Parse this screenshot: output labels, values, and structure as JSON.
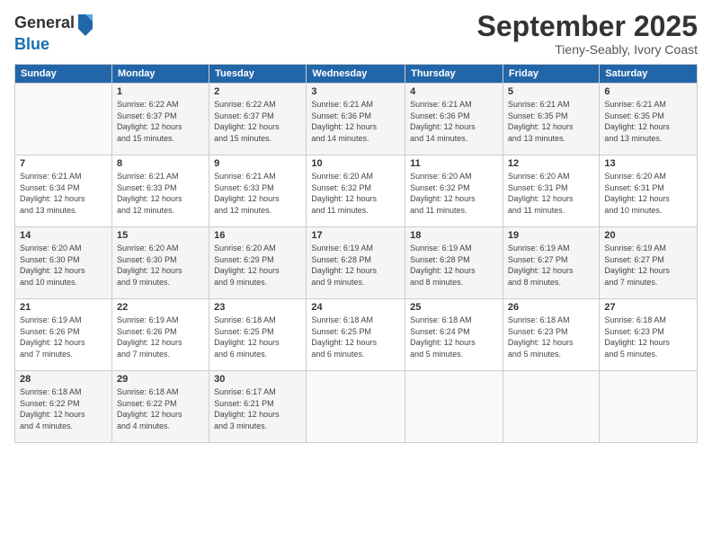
{
  "logo": {
    "general": "General",
    "blue": "Blue"
  },
  "title": "September 2025",
  "location": "Tieny-Seably, Ivory Coast",
  "days_header": [
    "Sunday",
    "Monday",
    "Tuesday",
    "Wednesday",
    "Thursday",
    "Friday",
    "Saturday"
  ],
  "weeks": [
    [
      {
        "num": "",
        "info": ""
      },
      {
        "num": "1",
        "info": "Sunrise: 6:22 AM\nSunset: 6:37 PM\nDaylight: 12 hours\nand 15 minutes."
      },
      {
        "num": "2",
        "info": "Sunrise: 6:22 AM\nSunset: 6:37 PM\nDaylight: 12 hours\nand 15 minutes."
      },
      {
        "num": "3",
        "info": "Sunrise: 6:21 AM\nSunset: 6:36 PM\nDaylight: 12 hours\nand 14 minutes."
      },
      {
        "num": "4",
        "info": "Sunrise: 6:21 AM\nSunset: 6:36 PM\nDaylight: 12 hours\nand 14 minutes."
      },
      {
        "num": "5",
        "info": "Sunrise: 6:21 AM\nSunset: 6:35 PM\nDaylight: 12 hours\nand 13 minutes."
      },
      {
        "num": "6",
        "info": "Sunrise: 6:21 AM\nSunset: 6:35 PM\nDaylight: 12 hours\nand 13 minutes."
      }
    ],
    [
      {
        "num": "7",
        "info": "Sunrise: 6:21 AM\nSunset: 6:34 PM\nDaylight: 12 hours\nand 13 minutes."
      },
      {
        "num": "8",
        "info": "Sunrise: 6:21 AM\nSunset: 6:33 PM\nDaylight: 12 hours\nand 12 minutes."
      },
      {
        "num": "9",
        "info": "Sunrise: 6:21 AM\nSunset: 6:33 PM\nDaylight: 12 hours\nand 12 minutes."
      },
      {
        "num": "10",
        "info": "Sunrise: 6:20 AM\nSunset: 6:32 PM\nDaylight: 12 hours\nand 11 minutes."
      },
      {
        "num": "11",
        "info": "Sunrise: 6:20 AM\nSunset: 6:32 PM\nDaylight: 12 hours\nand 11 minutes."
      },
      {
        "num": "12",
        "info": "Sunrise: 6:20 AM\nSunset: 6:31 PM\nDaylight: 12 hours\nand 11 minutes."
      },
      {
        "num": "13",
        "info": "Sunrise: 6:20 AM\nSunset: 6:31 PM\nDaylight: 12 hours\nand 10 minutes."
      }
    ],
    [
      {
        "num": "14",
        "info": "Sunrise: 6:20 AM\nSunset: 6:30 PM\nDaylight: 12 hours\nand 10 minutes."
      },
      {
        "num": "15",
        "info": "Sunrise: 6:20 AM\nSunset: 6:30 PM\nDaylight: 12 hours\nand 9 minutes."
      },
      {
        "num": "16",
        "info": "Sunrise: 6:20 AM\nSunset: 6:29 PM\nDaylight: 12 hours\nand 9 minutes."
      },
      {
        "num": "17",
        "info": "Sunrise: 6:19 AM\nSunset: 6:28 PM\nDaylight: 12 hours\nand 9 minutes."
      },
      {
        "num": "18",
        "info": "Sunrise: 6:19 AM\nSunset: 6:28 PM\nDaylight: 12 hours\nand 8 minutes."
      },
      {
        "num": "19",
        "info": "Sunrise: 6:19 AM\nSunset: 6:27 PM\nDaylight: 12 hours\nand 8 minutes."
      },
      {
        "num": "20",
        "info": "Sunrise: 6:19 AM\nSunset: 6:27 PM\nDaylight: 12 hours\nand 7 minutes."
      }
    ],
    [
      {
        "num": "21",
        "info": "Sunrise: 6:19 AM\nSunset: 6:26 PM\nDaylight: 12 hours\nand 7 minutes."
      },
      {
        "num": "22",
        "info": "Sunrise: 6:19 AM\nSunset: 6:26 PM\nDaylight: 12 hours\nand 7 minutes."
      },
      {
        "num": "23",
        "info": "Sunrise: 6:18 AM\nSunset: 6:25 PM\nDaylight: 12 hours\nand 6 minutes."
      },
      {
        "num": "24",
        "info": "Sunrise: 6:18 AM\nSunset: 6:25 PM\nDaylight: 12 hours\nand 6 minutes."
      },
      {
        "num": "25",
        "info": "Sunrise: 6:18 AM\nSunset: 6:24 PM\nDaylight: 12 hours\nand 5 minutes."
      },
      {
        "num": "26",
        "info": "Sunrise: 6:18 AM\nSunset: 6:23 PM\nDaylight: 12 hours\nand 5 minutes."
      },
      {
        "num": "27",
        "info": "Sunrise: 6:18 AM\nSunset: 6:23 PM\nDaylight: 12 hours\nand 5 minutes."
      }
    ],
    [
      {
        "num": "28",
        "info": "Sunrise: 6:18 AM\nSunset: 6:22 PM\nDaylight: 12 hours\nand 4 minutes."
      },
      {
        "num": "29",
        "info": "Sunrise: 6:18 AM\nSunset: 6:22 PM\nDaylight: 12 hours\nand 4 minutes."
      },
      {
        "num": "30",
        "info": "Sunrise: 6:17 AM\nSunset: 6:21 PM\nDaylight: 12 hours\nand 3 minutes."
      },
      {
        "num": "",
        "info": ""
      },
      {
        "num": "",
        "info": ""
      },
      {
        "num": "",
        "info": ""
      },
      {
        "num": "",
        "info": ""
      }
    ]
  ]
}
